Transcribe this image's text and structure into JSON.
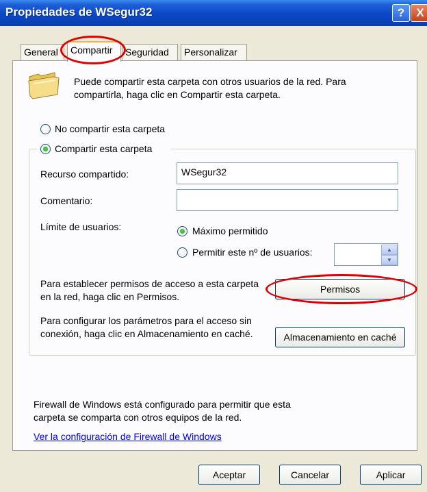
{
  "window": {
    "title": "Propiedades de WSegur32",
    "help_button": "?",
    "close_button": "X"
  },
  "tabs": [
    {
      "label": "General"
    },
    {
      "label": "Compartir"
    },
    {
      "label": "Seguridad"
    },
    {
      "label": "Personalizar"
    }
  ],
  "share": {
    "intro": "Puede compartir esta carpeta con otros usuarios de la red. Para compartirla, haga clic en Compartir esta carpeta.",
    "no_share_label": "No compartir esta carpeta",
    "share_label": "Compartir esta carpeta",
    "resource_label": "Recurso compartido:",
    "resource_value": "WSegur32",
    "comment_label": "Comentario:",
    "comment_value": "",
    "user_limit_label": "Límite de usuarios:",
    "max_allowed_label": "Máximo permitido",
    "allow_n_users_label": "Permitir este nº de usuarios:",
    "users_count_value": "",
    "permissions_text": "Para establecer permisos de acceso a esta carpeta en la red, haga clic en Permisos.",
    "permissions_button": "Permisos",
    "offline_text": "Para configurar los parámetros para el acceso sin conexión, haga clic en Almacenamiento en caché.",
    "cache_button": "Almacenamiento en caché",
    "firewall_text": "Firewall de Windows está configurado para permitir que esta carpeta se comparta con otros equipos de la red.",
    "firewall_link": "Ver la configuración de Firewall de Windows"
  },
  "footer": {
    "ok": "Aceptar",
    "cancel": "Cancelar",
    "apply": "Aplicar"
  },
  "colors": {
    "titlebar": "#0a47c8",
    "annotation": "#e00000",
    "radio_checked": "#1f9c1f"
  }
}
